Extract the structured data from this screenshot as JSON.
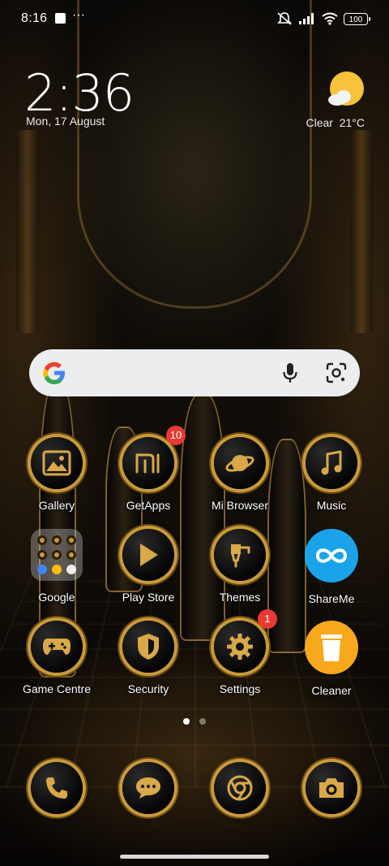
{
  "status_bar": {
    "time": "8:16",
    "more": "···",
    "battery": "100"
  },
  "clock_widget": {
    "time": "2:36",
    "date": "Mon, 17 August"
  },
  "weather_widget": {
    "condition": "Clear",
    "temperature": "21°C",
    "icon": "sun-cloud-icon"
  },
  "search_bar": {
    "logo": "google-g-icon",
    "mic_icon": "microphone-icon",
    "lens_icon": "lens-camera-icon"
  },
  "apps": [
    {
      "label": "Gallery",
      "icon": "gallery-icon"
    },
    {
      "label": "GetApps",
      "icon": "mi-store-icon",
      "badge": "10"
    },
    {
      "label": "Mi Browser",
      "icon": "planet-icon"
    },
    {
      "label": "Music",
      "icon": "music-note-icon"
    },
    {
      "label": "Google",
      "icon": "folder-icon"
    },
    {
      "label": "Play Store",
      "icon": "play-icon"
    },
    {
      "label": "Themes",
      "icon": "paintbrush-icon"
    },
    {
      "label": "ShareMe",
      "icon": "infinity-icon"
    },
    {
      "label": "Game Centre",
      "icon": "gamepad-icon"
    },
    {
      "label": "Security",
      "icon": "shield-icon"
    },
    {
      "label": "Settings",
      "icon": "gear-icon",
      "badge": "1"
    },
    {
      "label": "Cleaner",
      "icon": "trash-icon"
    }
  ],
  "page_indicator": {
    "pages": 2,
    "current": 1
  },
  "dock": [
    {
      "name": "phone",
      "icon": "phone-icon"
    },
    {
      "name": "messages",
      "icon": "message-bubble-icon"
    },
    {
      "name": "chrome",
      "icon": "chrome-icon"
    },
    {
      "name": "camera",
      "icon": "camera-icon"
    }
  ],
  "colors": {
    "gold": "#d9a848",
    "badge": "#e83a32",
    "shareme": "#1aa3e8",
    "cleaner": "#f7a81b"
  }
}
